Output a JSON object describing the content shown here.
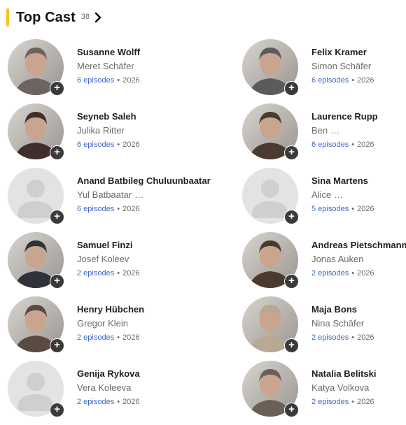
{
  "header": {
    "title": "Top Cast",
    "count": "38",
    "chevron_icon": "chevron-right-icon"
  },
  "accent_color": "#f5c518",
  "cast": [
    {
      "name": "Susanne Wolff",
      "character": "Meret Schäfer",
      "more": "",
      "episodes": "6 episodes",
      "year": "2026",
      "photo": true,
      "tone": "#6d6460"
    },
    {
      "name": "Felix Kramer",
      "character": "Simon Schäfer",
      "more": "",
      "episodes": "6 episodes",
      "year": "2026",
      "photo": true,
      "tone": "#5b5b5b"
    },
    {
      "name": "Seyneb Saleh",
      "character": "Julika Ritter",
      "more": "",
      "episodes": "6 episodes",
      "year": "2026",
      "photo": true,
      "tone": "#3f2f2a"
    },
    {
      "name": "Laurence Rupp",
      "character": "Ben",
      "more": "…",
      "episodes": "6 episodes",
      "year": "2026",
      "photo": true,
      "tone": "#4a3a30"
    },
    {
      "name": "Anand Batbileg Chuluunbaatar",
      "character": "Yul Batbaatar",
      "more": "…",
      "episodes": "6 episodes",
      "year": "2026",
      "photo": false,
      "tone": ""
    },
    {
      "name": "Sina Martens",
      "character": "Alice",
      "more": "…",
      "episodes": "5 episodes",
      "year": "2026",
      "photo": false,
      "tone": ""
    },
    {
      "name": "Samuel Finzi",
      "character": "Josef Koleev",
      "more": "",
      "episodes": "2 episodes",
      "year": "2026",
      "photo": true,
      "tone": "#2f3238"
    },
    {
      "name": "Andreas Pietschmann",
      "character": "Jonas Auken",
      "more": "",
      "episodes": "2 episodes",
      "year": "2026",
      "photo": true,
      "tone": "#4b3b2f"
    },
    {
      "name": "Henry Hübchen",
      "character": "Gregor Klein",
      "more": "",
      "episodes": "2 episodes",
      "year": "2026",
      "photo": true,
      "tone": "#5a4a44"
    },
    {
      "name": "Maja Bons",
      "character": "Nina Schäfer",
      "more": "",
      "episodes": "2 episodes",
      "year": "2026",
      "photo": true,
      "tone": "#b8a894"
    },
    {
      "name": "Genija Rykova",
      "character": "Vera Koleeva",
      "more": "",
      "episodes": "2 episodes",
      "year": "2026",
      "photo": false,
      "tone": ""
    },
    {
      "name": "Natalia Belitski",
      "character": "Katya Volkova",
      "more": "",
      "episodes": "2 episodes",
      "year": "2026",
      "photo": true,
      "tone": "#6a6055"
    }
  ],
  "separator": "•",
  "add_icon": "plus-icon"
}
